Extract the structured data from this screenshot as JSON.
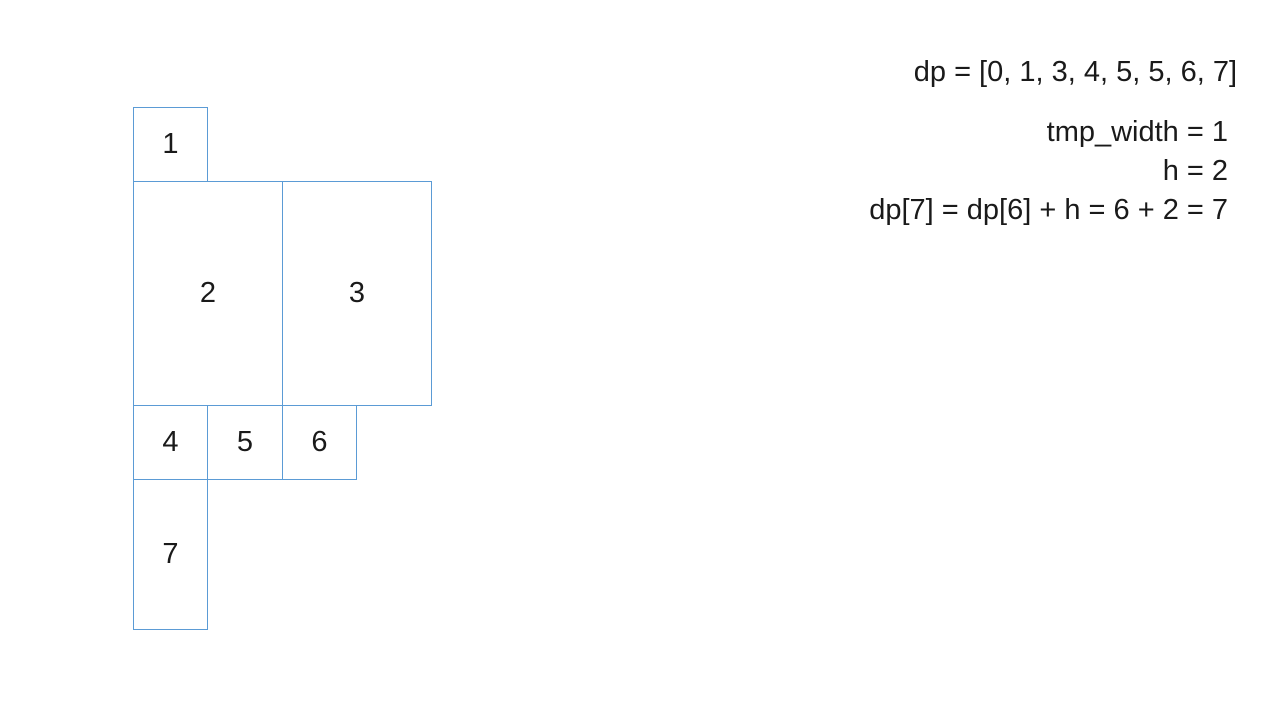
{
  "blocks": [
    {
      "label": "1"
    },
    {
      "label": "2"
    },
    {
      "label": "3"
    },
    {
      "label": "4"
    },
    {
      "label": "5"
    },
    {
      "label": "6"
    },
    {
      "label": "7"
    }
  ],
  "annotations": {
    "dp_array": "dp = [0, 1, 3, 4, 5, 5, 6, 7]",
    "tmp_width": "tmp_width = 1",
    "h": "h = 2",
    "dp_calc": "dp[7] = dp[6] + h = 6 + 2 = 7"
  },
  "colors": {
    "box_border": "#5b9bd5",
    "text": "#1a1a1a",
    "background": "#ffffff"
  }
}
